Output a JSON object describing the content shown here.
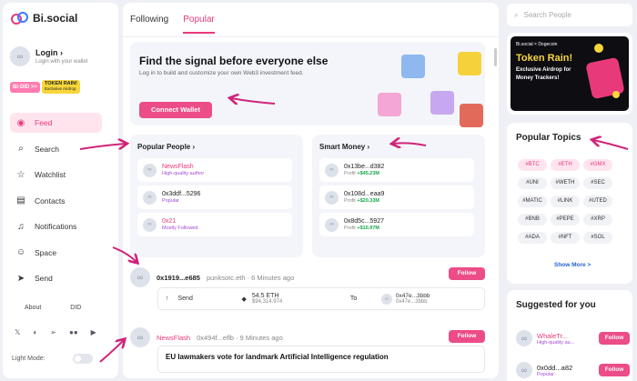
{
  "brand": {
    "name": "Bi.social"
  },
  "login": {
    "title": "Login ›",
    "sub": "Login with your wallet"
  },
  "promo_mini": {
    "left": "Bi·DID >>",
    "right_top": "TOKEN RAIN!",
    "right_bottom": "Exclusive Airdrop"
  },
  "nav": [
    {
      "label": "Feed",
      "icon": "rss-icon",
      "glyph": "◉"
    },
    {
      "label": "Search",
      "icon": "search-icon",
      "glyph": "⌕"
    },
    {
      "label": "Watchlist",
      "icon": "star-icon",
      "glyph": "☆"
    },
    {
      "label": "Contacts",
      "icon": "contacts-icon",
      "glyph": "▤"
    },
    {
      "label": "Notifications",
      "icon": "bell-icon",
      "glyph": "♫"
    },
    {
      "label": "Space",
      "icon": "user-icon",
      "glyph": "☺"
    },
    {
      "label": "Send",
      "icon": "send-icon",
      "glyph": "➤"
    }
  ],
  "side_links": {
    "about": "About",
    "did": "DID"
  },
  "lightmode": "Light Mode:",
  "tabs": [
    "Following",
    "Popular"
  ],
  "hero": {
    "title": "Find the signal before everyone else",
    "desc": "Log in to build and customize your own Web3 investment feed.",
    "button": "Connect Wallet"
  },
  "popular_people": {
    "title": "Popular People ›",
    "rows": [
      {
        "name": "NewsFlash",
        "sub": "High-quality author"
      },
      {
        "name": "0x3ddf...5296",
        "sub": "Popular"
      },
      {
        "name": "0x21",
        "sub": "Mostly Followed"
      }
    ]
  },
  "smart_money": {
    "title": "Smart Money ›",
    "rows": [
      {
        "name": "0x13be...d382",
        "label": "Profit",
        "value": "+$45.23M"
      },
      {
        "name": "0x108d...eaa9",
        "label": "Profit",
        "value": "+$20.33M"
      },
      {
        "name": "0x8d5c...5927",
        "label": "Profit",
        "value": "+$10.97M"
      }
    ]
  },
  "activity1": {
    "addr": "0x1919...e685",
    "meta": "punksotc.eth · 6 Minutes ago",
    "follow": "Follow",
    "action": "Send",
    "amount": "54.5 ETH",
    "usd": "$94,314.974",
    "to": "To",
    "to_addr": "0x47e...3bbb",
    "to_addr2": "0x47e...3bbb"
  },
  "activity2": {
    "name": "NewsFlash",
    "meta": "0x494f...eflb · 9 Minutes ago",
    "follow": "Follow",
    "headline": "EU lawmakers vote for landmark Artificial Intelligence regulation"
  },
  "search": {
    "placeholder": "Search People"
  },
  "ad": {
    "brand": "Bi.social × Dogecoin",
    "title": "Token Rain!",
    "line1": "Exclusive Airdrop for",
    "line2": "Money Trackers!"
  },
  "topics": {
    "title": "Popular Topics",
    "chips": [
      "#BTC",
      "#ETH",
      "#GMX",
      "#UNI",
      "#WETH",
      "#SEC",
      "#MATIC",
      "#LINK",
      "#UTED",
      "#BNB",
      "#PEPE",
      "#XRP",
      "#ADA",
      "#NFT",
      "#SOL"
    ],
    "show_more": "Show More >"
  },
  "suggested": {
    "title": "Suggested for you",
    "rows": [
      {
        "name": "WhaleTr...",
        "sub": "High-quality au..."
      },
      {
        "name": "0x0dd...a82",
        "sub": "Popular"
      }
    ],
    "follow": "Follow"
  },
  "colors": {
    "accent": "#e8397a",
    "profit": "#18a64a",
    "annotation_arrow": "#d0237a"
  }
}
